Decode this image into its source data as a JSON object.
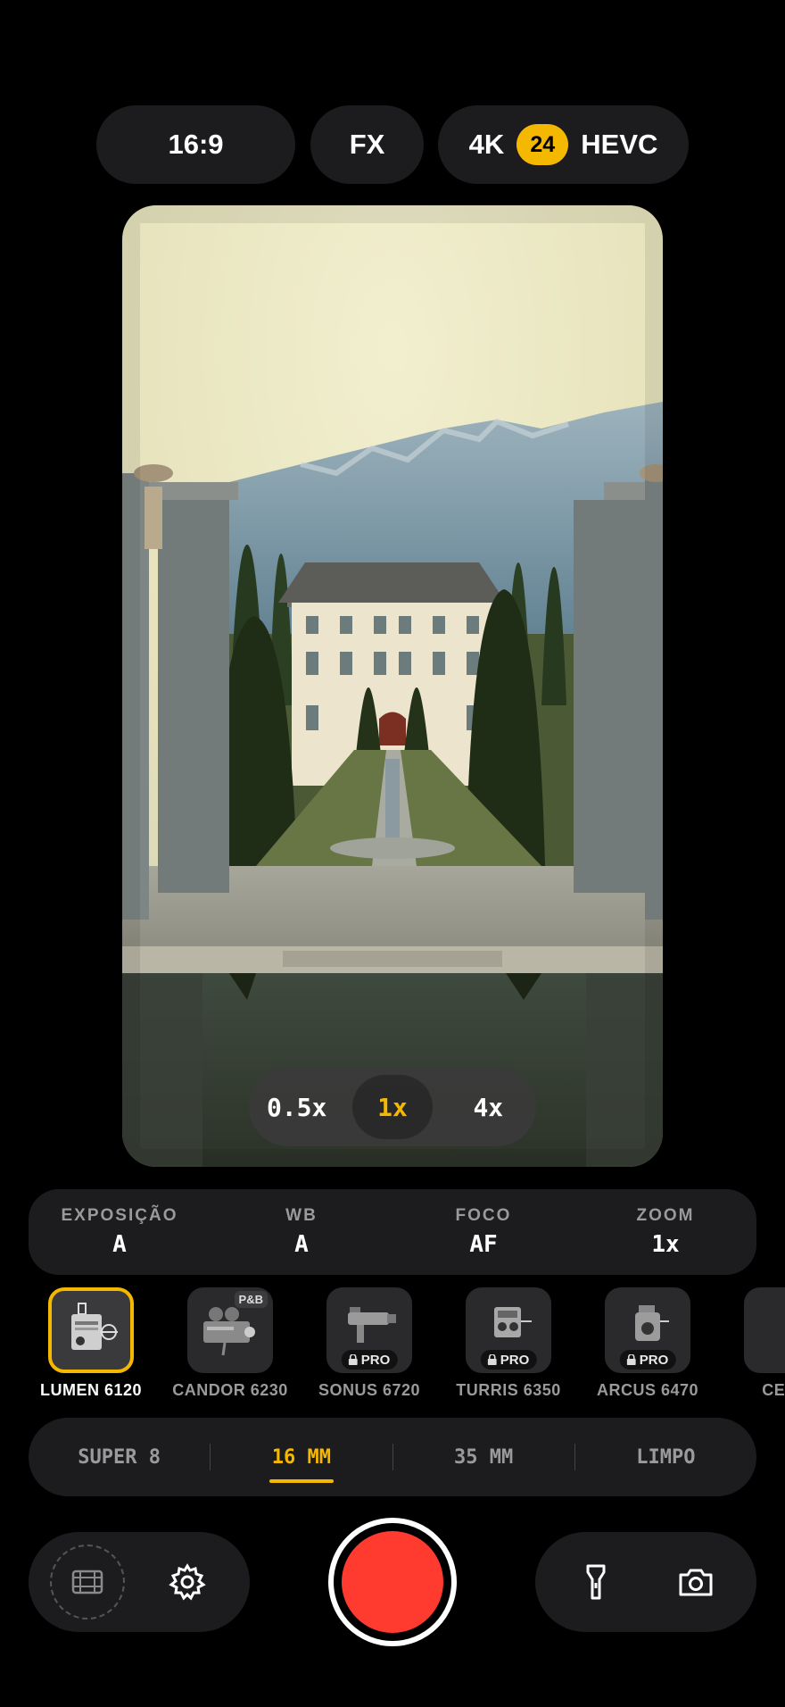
{
  "top_bar": {
    "aspect_ratio": "16:9",
    "fx": "FX",
    "resolution": "4K",
    "fps": "24",
    "codec": "HEVC"
  },
  "zoom_presets": [
    {
      "label": "0.5x",
      "active": false
    },
    {
      "label": "1x",
      "active": true
    },
    {
      "label": "4x",
      "active": false
    }
  ],
  "settings": [
    {
      "label": "EXPOSIÇÃO",
      "value": "A"
    },
    {
      "label": "WB",
      "value": "A"
    },
    {
      "label": "FOCO",
      "value": "AF"
    },
    {
      "label": "ZOOM",
      "value": "1x"
    }
  ],
  "cameras": [
    {
      "name": "LUMEN 6120",
      "selected": true,
      "badge": ""
    },
    {
      "name": "CANDOR 6230",
      "selected": false,
      "badge": "P&B"
    },
    {
      "name": "SONUS 6720",
      "selected": false,
      "badge": "PRO"
    },
    {
      "name": "TURRIS 6350",
      "selected": false,
      "badge": "PRO"
    },
    {
      "name": "ARCUS 6470",
      "selected": false,
      "badge": "PRO"
    },
    {
      "name": "CELEI",
      "selected": false,
      "badge": ""
    }
  ],
  "film_formats": [
    {
      "label": "SUPER 8",
      "active": false
    },
    {
      "label": "16 MM",
      "active": true
    },
    {
      "label": "35 MM",
      "active": false
    },
    {
      "label": "LIMPO",
      "active": false
    }
  ],
  "icons": {
    "gallery": "film-frame-icon",
    "settings": "gear-icon",
    "flashlight": "flashlight-icon",
    "camera": "camera-icon",
    "lock": "lock-icon"
  },
  "colors": {
    "accent": "#f5b800",
    "record": "#ff3b30",
    "surface": "#1c1c1e"
  }
}
